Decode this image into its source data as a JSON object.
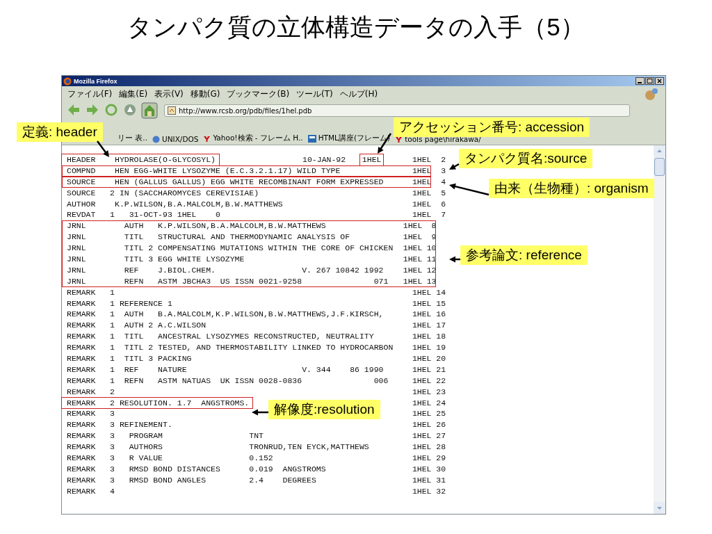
{
  "title": "タンパク質の立体構造データの入手（5）",
  "window": {
    "title": "Mozilla Firefox"
  },
  "menu": [
    "ファイル(F)",
    "編集(E)",
    "表示(V)",
    "移動(G)",
    "ブックマーク(B)",
    "ツール(T)",
    "ヘルプ(H)"
  ],
  "url": "http://www.rcsb.org/pdb/files/1hel.pdb",
  "bookmarks": [
    {
      "label": "リー 表..",
      "kind": "none"
    },
    {
      "label": "UNIX/DOS",
      "kind": "globe"
    },
    {
      "label": "Yahoo!検索 - フレーム H..",
      "kind": "mark"
    },
    {
      "label": "HTML講座(フレーム)",
      "kind": "page"
    },
    {
      "label": "tools page\\hirakawa/",
      "kind": "mark"
    }
  ],
  "rows": [
    {
      "text": "HEADER    HYDROLASE(O-GLYCOSYL)",
      "date": "10-JAN-92",
      "code": "1HEL",
      "code_boxed": true,
      "text_boxed": true,
      "id": "1HEL",
      "serial": "2"
    },
    {
      "text": "COMPND    HEN EGG-WHITE LYSOZYME (E.C.3.2.1.17) WILD TYPE",
      "line_boxed": true,
      "id": "1HEL",
      "serial": "3"
    },
    {
      "text": "SOURCE    HEN (GALLUS GALLUS) EGG WHITE RECOMBINANT FORM EXPRESSED",
      "line_boxed": true,
      "id": "1HEL",
      "serial": "4"
    },
    {
      "text": "SOURCE   2 IN (SACCHAROMYCES CEREVISIAE)",
      "id": "1HEL",
      "serial": "5"
    },
    {
      "text": "AUTHOR    K.P.WILSON,B.A.MALCOLM,B.W.MATTHEWS",
      "id": "1HEL",
      "serial": "6"
    },
    {
      "text": "REVDAT   1   31-OCT-93 1HEL    0",
      "id": "1HEL",
      "serial": "7"
    },
    {
      "text": "JRNL        AUTH   K.P.WILSON,B.A.MALCOLM,B.W.MATTHEWS",
      "block_boxed": true,
      "id": "1HEL",
      "serial": "8"
    },
    {
      "text": "JRNL        TITL   STRUCTURAL AND THERMODYNAMIC ANALYSIS OF",
      "block_boxed": true,
      "id": "1HEL",
      "serial": "9"
    },
    {
      "text": "JRNL        TITL 2 COMPENSATING MUTATIONS WITHIN THE CORE OF CHICKEN",
      "block_boxed": true,
      "id": "1HEL",
      "serial": "10"
    },
    {
      "text": "JRNL        TITL 3 EGG WHITE LYSOZYME",
      "block_boxed": true,
      "id": "1HEL",
      "serial": "11"
    },
    {
      "text": "JRNL        REF    J.BIOL.CHEM.                  V. 267 10842 1992",
      "block_boxed": true,
      "id": "1HEL",
      "serial": "12"
    },
    {
      "text": "JRNL        REFN   ASTM JBCHA3  US ISSN 0021-9258               071",
      "block_boxed": true,
      "id": "1HEL",
      "serial": "13"
    },
    {
      "text": "REMARK   1",
      "id": "1HEL",
      "serial": "14"
    },
    {
      "text": "REMARK   1 REFERENCE 1",
      "id": "1HEL",
      "serial": "15"
    },
    {
      "text": "REMARK   1  AUTH   B.A.MALCOLM,K.P.WILSON,B.W.MATTHEWS,J.F.KIRSCH,",
      "id": "1HEL",
      "serial": "16"
    },
    {
      "text": "REMARK   1  AUTH 2 A.C.WILSON",
      "id": "1HEL",
      "serial": "17"
    },
    {
      "text": "REMARK   1  TITL   ANCESTRAL LYSOZYMES RECONSTRUCTED, NEUTRALITY",
      "id": "1HEL",
      "serial": "18"
    },
    {
      "text": "REMARK   1  TITL 2 TESTED, AND THERMOSTABILITY LINKED TO HYDROCARBON",
      "id": "1HEL",
      "serial": "19"
    },
    {
      "text": "REMARK   1  TITL 3 PACKING",
      "id": "1HEL",
      "serial": "20"
    },
    {
      "text": "REMARK   1  REF    NATURE                        V. 344    86 1990",
      "id": "1HEL",
      "serial": "21"
    },
    {
      "text": "REMARK   1  REFN   ASTM NATUAS  UK ISSN 0028-0836               006",
      "id": "1HEL",
      "serial": "22"
    },
    {
      "text": "REMARK   2",
      "id": "1HEL",
      "serial": "23"
    },
    {
      "text": "REMARK   2 RESOLUTION. 1.7  ANGSTROMS.",
      "text_boxed": true,
      "id": "1HEL",
      "serial": "24"
    },
    {
      "text": "REMARK   3",
      "id": "1HEL",
      "serial": "25"
    },
    {
      "text": "REMARK   3 REFINEMENT.",
      "id": "1HEL",
      "serial": "26"
    },
    {
      "text": "REMARK   3   PROGRAM                  TNT",
      "id": "1HEL",
      "serial": "27"
    },
    {
      "text": "REMARK   3   AUTHORS                  TRONRUD,TEN EYCK,MATTHEWS",
      "id": "1HEL",
      "serial": "28"
    },
    {
      "text": "REMARK   3   R VALUE                  0.152",
      "id": "1HEL",
      "serial": "29"
    },
    {
      "text": "REMARK   3   RMSD BOND DISTANCES      0.019  ANGSTROMS",
      "id": "1HEL",
      "serial": "30"
    },
    {
      "text": "REMARK   3   RMSD BOND ANGLES         2.4    DEGREES",
      "id": "1HEL",
      "serial": "31"
    },
    {
      "text": "REMARK   4",
      "id": "1HEL",
      "serial": "32"
    }
  ],
  "callouts": [
    {
      "label": "定義: header"
    },
    {
      "label": "アクセッション番号: accession"
    },
    {
      "label": "タンパク質名:source"
    },
    {
      "label": "由来（生物種）: organism"
    },
    {
      "label": "参考論文: reference"
    },
    {
      "label": "解像度:resolution"
    }
  ]
}
